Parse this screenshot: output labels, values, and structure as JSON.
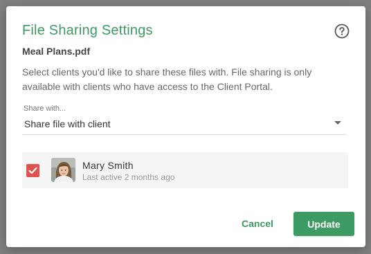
{
  "dialog": {
    "title": "File Sharing Settings",
    "filename": "Meal Plans.pdf",
    "description": "Select clients you'd like to share these files with. File sharing is only available with clients who have access to the Client Portal.",
    "help_icon": "help-circle-icon"
  },
  "share_select": {
    "label": "Share with...",
    "value": "Share file with client"
  },
  "clients": [
    {
      "name": "Mary Smith",
      "last_active": "Last active 2 months ago",
      "checked": true
    }
  ],
  "actions": {
    "cancel_label": "Cancel",
    "update_label": "Update"
  },
  "colors": {
    "accent": "#3c9a63",
    "checkbox": "#e0524f"
  }
}
